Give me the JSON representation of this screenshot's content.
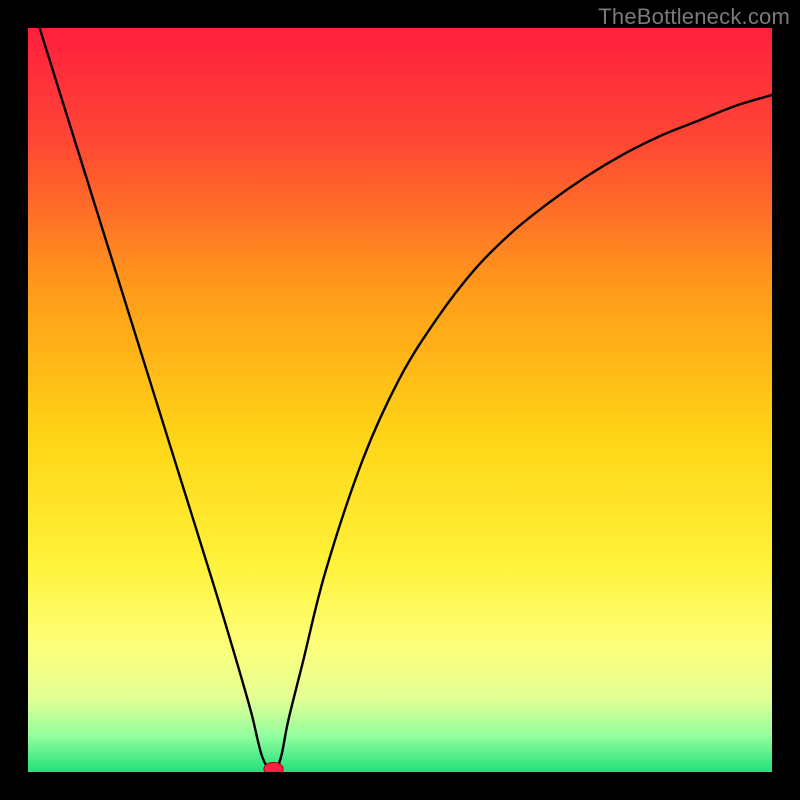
{
  "watermark": "TheBottleneck.com",
  "chart_data": {
    "type": "line",
    "title": "",
    "xlabel": "",
    "ylabel": "",
    "xlim": [
      0,
      100
    ],
    "ylim": [
      0,
      100
    ],
    "grid": false,
    "legend": false,
    "background_gradient": {
      "stops": [
        {
          "offset": 0.0,
          "color": "#ff1f3e"
        },
        {
          "offset": 0.15,
          "color": "#ff4634"
        },
        {
          "offset": 0.35,
          "color": "#ff9a1a"
        },
        {
          "offset": 0.55,
          "color": "#ffd516"
        },
        {
          "offset": 0.72,
          "color": "#fff23a"
        },
        {
          "offset": 0.83,
          "color": "#fdff7a"
        },
        {
          "offset": 0.9,
          "color": "#e4ff94"
        },
        {
          "offset": 0.95,
          "color": "#95ff9e"
        },
        {
          "offset": 1.0,
          "color": "#22e07a"
        }
      ]
    },
    "series": [
      {
        "name": "bottleneck-curve",
        "x": [
          0,
          5,
          10,
          15,
          20,
          25,
          28,
          30,
          31.5,
          33,
          34,
          35,
          37,
          40,
          45,
          50,
          55,
          60,
          65,
          70,
          75,
          80,
          85,
          90,
          95,
          100
        ],
        "values": [
          105,
          89,
          73,
          57,
          41,
          25,
          15,
          8,
          2,
          0,
          2,
          7,
          15,
          27,
          42,
          53,
          61,
          67.5,
          72.5,
          76.5,
          80,
          83,
          85.5,
          87.5,
          89.5,
          91
        ],
        "color": "#000000",
        "linewidth": 2.4
      }
    ],
    "marker": {
      "name": "optimal-point",
      "x": 33,
      "y": 0.4,
      "rx": 1.3,
      "ry": 0.9,
      "fill": "#ff1f3e",
      "stroke": "#aa0020"
    }
  }
}
